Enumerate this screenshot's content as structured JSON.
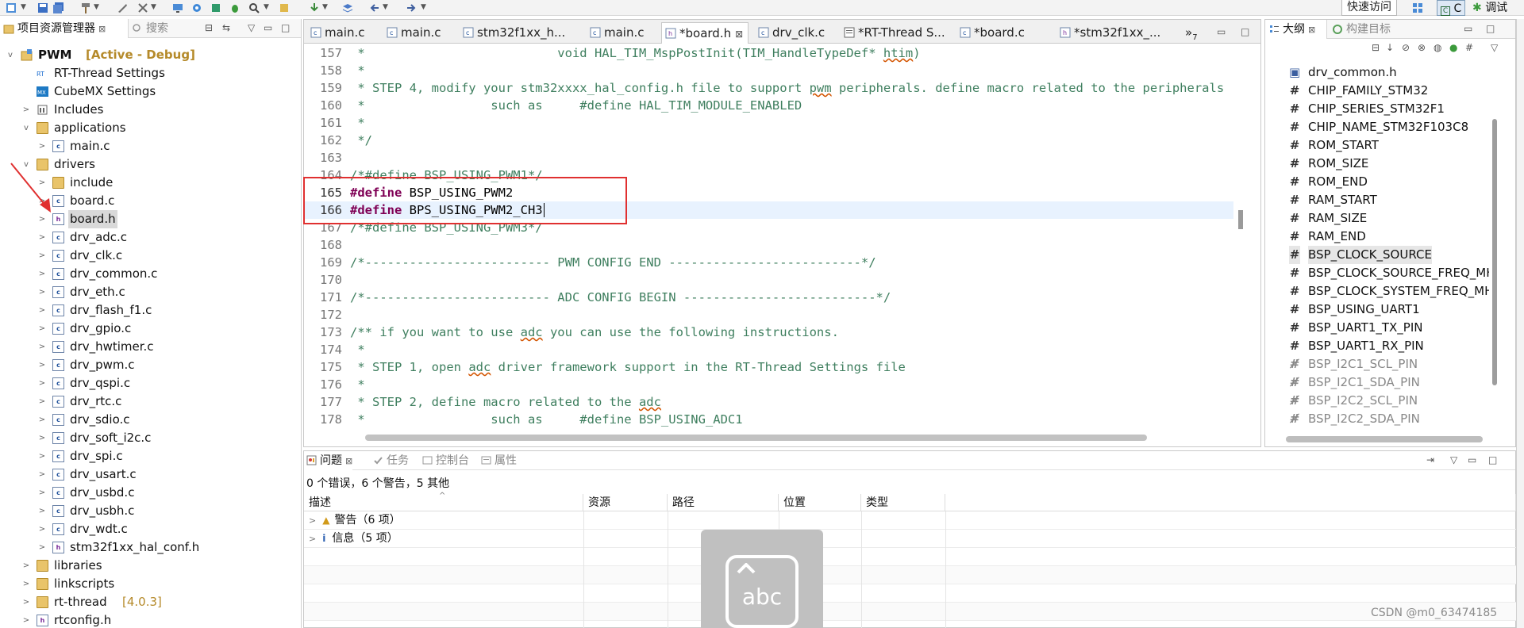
{
  "toolbar": {
    "quick_access": "快速访问",
    "perspective_c": "C",
    "perspective_debug": "调试"
  },
  "explorer": {
    "tab_label": "项目资源管理器",
    "tab_search": "搜索",
    "project_name": "PWM",
    "project_state": "[Active - Debug]",
    "items": [
      {
        "label": "RT-Thread Settings",
        "extra": ""
      },
      {
        "label": "CubeMX Settings",
        "extra": ""
      },
      {
        "label": "Includes",
        "extra": ""
      },
      {
        "label": "applications",
        "extra": ""
      },
      {
        "label": "main.c",
        "extra": ""
      },
      {
        "label": "drivers",
        "extra": ""
      },
      {
        "label": "include",
        "extra": ""
      },
      {
        "label": "board.c",
        "extra": ""
      },
      {
        "label": "board.h",
        "extra": ""
      },
      {
        "label": "drv_adc.c",
        "extra": ""
      },
      {
        "label": "drv_clk.c",
        "extra": ""
      },
      {
        "label": "drv_common.c",
        "extra": ""
      },
      {
        "label": "drv_eth.c",
        "extra": ""
      },
      {
        "label": "drv_flash_f1.c",
        "extra": ""
      },
      {
        "label": "drv_gpio.c",
        "extra": ""
      },
      {
        "label": "drv_hwtimer.c",
        "extra": ""
      },
      {
        "label": "drv_pwm.c",
        "extra": ""
      },
      {
        "label": "drv_qspi.c",
        "extra": ""
      },
      {
        "label": "drv_rtc.c",
        "extra": ""
      },
      {
        "label": "drv_sdio.c",
        "extra": ""
      },
      {
        "label": "drv_soft_i2c.c",
        "extra": ""
      },
      {
        "label": "drv_spi.c",
        "extra": ""
      },
      {
        "label": "drv_usart.c",
        "extra": ""
      },
      {
        "label": "drv_usbd.c",
        "extra": ""
      },
      {
        "label": "drv_usbh.c",
        "extra": ""
      },
      {
        "label": "drv_wdt.c",
        "extra": ""
      },
      {
        "label": "stm32f1xx_hal_conf.h",
        "extra": ""
      },
      {
        "label": "libraries",
        "extra": ""
      },
      {
        "label": "linkscripts",
        "extra": ""
      },
      {
        "label": "rt-thread",
        "extra": "[4.0.3]"
      },
      {
        "label": "rtconfig.h",
        "extra": ""
      }
    ]
  },
  "editor": {
    "tabs": [
      {
        "label": "main.c"
      },
      {
        "label": "main.c"
      },
      {
        "label": "stm32f1xx_h..."
      },
      {
        "label": "main.c"
      },
      {
        "label": "*board.h"
      },
      {
        "label": "drv_clk.c"
      },
      {
        "label": "*RT-Thread S..."
      },
      {
        "label": "*board.c"
      },
      {
        "label": "*stm32f1xx_..."
      }
    ],
    "overflow_label": "»",
    "overflow_count": "7",
    "lines": [
      {
        "n": "157",
        "pre": " *                          void HAL_TIM_MspPostInit(TIM_HandleTypeDef* ",
        "sq": "htim",
        "post": ")"
      },
      {
        "n": "158",
        "pre": " *",
        "sq": "",
        "post": ""
      },
      {
        "n": "159",
        "pre": " * STEP 4, modify your stm32xxxx_hal_config.h file to support ",
        "sq": "pwm",
        "post": " peripherals. define macro related to the peripherals"
      },
      {
        "n": "160",
        "pre": " *                 such as     #define HAL_TIM_MODULE_ENABLED",
        "sq": "",
        "post": ""
      },
      {
        "n": "161",
        "pre": " *",
        "sq": "",
        "post": ""
      },
      {
        "n": "162",
        "pre": " */",
        "sq": "",
        "post": ""
      },
      {
        "n": "163",
        "pre": "",
        "sq": "",
        "post": ""
      },
      {
        "n": "164",
        "pre": "/*#define BSP_USING_PWM1*/",
        "sq": "",
        "post": ""
      },
      {
        "n": "165",
        "kw": "#define",
        "macro": " BSP_USING_PWM2"
      },
      {
        "n": "166",
        "kw": "#define",
        "macro": " BPS_USING_PWM2_CH3"
      },
      {
        "n": "167",
        "pre": "/*#define BSP_USING_PWM3*/",
        "sq": "",
        "post": ""
      },
      {
        "n": "168",
        "pre": "",
        "sq": "",
        "post": ""
      },
      {
        "n": "169",
        "pre": "/*------------------------- PWM CONFIG END --------------------------*/",
        "sq": "",
        "post": ""
      },
      {
        "n": "170",
        "pre": "",
        "sq": "",
        "post": ""
      },
      {
        "n": "171",
        "pre": "/*------------------------- ADC CONFIG BEGIN --------------------------*/",
        "sq": "",
        "post": ""
      },
      {
        "n": "172",
        "pre": "",
        "sq": "",
        "post": ""
      },
      {
        "n": "173",
        "pre": "/** if you want to use ",
        "sq": "adc",
        "post": " you can use the following instructions."
      },
      {
        "n": "174",
        "pre": " *",
        "sq": "",
        "post": ""
      },
      {
        "n": "175",
        "pre": " * STEP 1, open ",
        "sq": "adc",
        "post": " driver framework support in the RT-Thread Settings file"
      },
      {
        "n": "176",
        "pre": " *",
        "sq": "",
        "post": ""
      },
      {
        "n": "177",
        "pre": " * STEP 2, define macro related to the ",
        "sq": "adc",
        "post": ""
      },
      {
        "n": "178",
        "pre": " *                 such as     #define BSP_USING_ADC1",
        "sq": "",
        "post": ""
      }
    ]
  },
  "outline": {
    "tab_label": "大纲",
    "tab_build": "构建目标",
    "items": [
      {
        "label": "drv_common.h",
        "kind": "include"
      },
      {
        "label": "CHIP_FAMILY_STM32",
        "kind": "macro"
      },
      {
        "label": "CHIP_SERIES_STM32F1",
        "kind": "macro"
      },
      {
        "label": "CHIP_NAME_STM32F103C8",
        "kind": "macro"
      },
      {
        "label": "ROM_START",
        "kind": "macro"
      },
      {
        "label": "ROM_SIZE",
        "kind": "macro"
      },
      {
        "label": "ROM_END",
        "kind": "macro"
      },
      {
        "label": "RAM_START",
        "kind": "macro"
      },
      {
        "label": "RAM_SIZE",
        "kind": "macro"
      },
      {
        "label": "RAM_END",
        "kind": "macro"
      },
      {
        "label": "BSP_CLOCK_SOURCE",
        "kind": "macro"
      },
      {
        "label": "BSP_CLOCK_SOURCE_FREQ_MHZ",
        "kind": "macro"
      },
      {
        "label": "BSP_CLOCK_SYSTEM_FREQ_MHZ",
        "kind": "macro"
      },
      {
        "label": "BSP_USING_UART1",
        "kind": "macro"
      },
      {
        "label": "BSP_UART1_TX_PIN",
        "kind": "macro"
      },
      {
        "label": "BSP_UART1_RX_PIN",
        "kind": "macro"
      },
      {
        "label": "BSP_I2C1_SCL_PIN",
        "kind": "inactive"
      },
      {
        "label": "BSP_I2C1_SDA_PIN",
        "kind": "inactive"
      },
      {
        "label": "BSP_I2C2_SCL_PIN",
        "kind": "inactive"
      },
      {
        "label": "BSP_I2C2_SDA_PIN",
        "kind": "inactive"
      }
    ]
  },
  "problems": {
    "tabs": [
      {
        "label": "问题"
      },
      {
        "label": "任务"
      },
      {
        "label": "控制台"
      },
      {
        "label": "属性"
      }
    ],
    "summary": "0 个错误，6 个警告，5 其他",
    "columns": [
      "描述",
      "资源",
      "路径",
      "位置",
      "类型"
    ],
    "rows": [
      {
        "label": "警告（6 项）"
      },
      {
        "label": "信息（5 项）"
      }
    ]
  },
  "ime": {
    "text": "abc"
  },
  "watermark": "CSDN @m0_63474185",
  "colors": {
    "comment": "#3f7f5f",
    "keyword": "#7f0055",
    "annotation_box": "#e03030",
    "folder": "#e9c46a"
  }
}
